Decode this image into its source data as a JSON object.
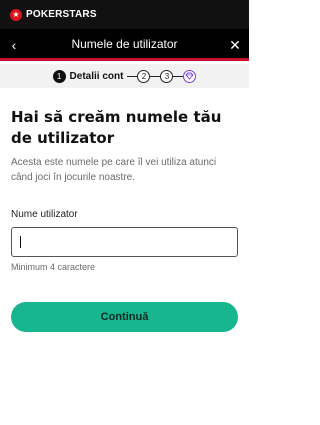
{
  "brand": {
    "logo_text": "POKERSTARS",
    "accent_red": "#c8102e",
    "primary_green": "#18b68f"
  },
  "nav": {
    "back_icon": "chevron-left-icon",
    "title": "Numele de utilizator",
    "close_icon": "close-icon"
  },
  "stepper": {
    "steps": [
      {
        "number": "1",
        "label": "Detalii cont",
        "active": true
      },
      {
        "number": "2",
        "label": "",
        "active": false
      },
      {
        "number": "3",
        "label": "",
        "active": false
      },
      {
        "number": "",
        "label": "",
        "icon": "diamond-icon",
        "active": false
      }
    ]
  },
  "form": {
    "heading": "Hai să creăm numele tău de utilizator",
    "description": "Acesta este numele pe care îl vei utiliza atunci când joci în jocurile noastre.",
    "field_label": "Nume utilizator",
    "input_value": "",
    "hint": "Minimum 4 caractere",
    "continue_label": "Continuă"
  }
}
